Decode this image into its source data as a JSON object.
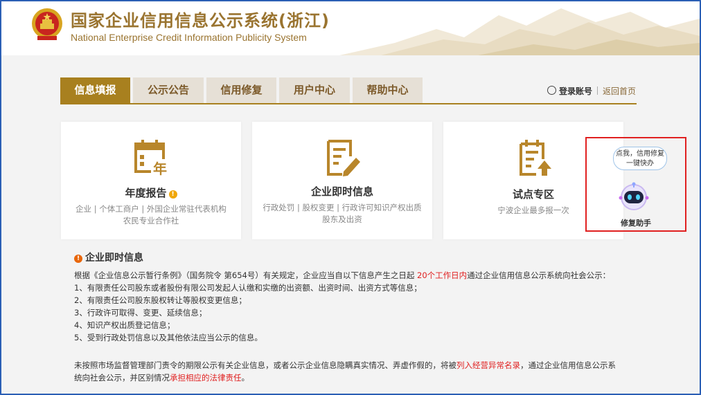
{
  "header": {
    "title": "国家企业信用信息公示系统(浙江)",
    "subtitle": "National Enterprise Credit Information Publicity System"
  },
  "tabs": [
    {
      "label": "信息填报",
      "active": true
    },
    {
      "label": "公示公告",
      "active": false
    },
    {
      "label": "信用修复",
      "active": false
    },
    {
      "label": "用户中心",
      "active": false
    },
    {
      "label": "帮助中心",
      "active": false
    }
  ],
  "account": {
    "login_label": "登录账号",
    "home_label": "返回首页"
  },
  "cards": [
    {
      "title": "年度报告",
      "icon": "annual-report-calendar-icon",
      "badge_icon": "warning-icon",
      "badge_text": "!",
      "desc_line1": "企业 | 个体工商户 | 外国企业常驻代表机构",
      "desc_line2": "农民专业合作社"
    },
    {
      "title": "企业即时信息",
      "icon": "edit-document-icon",
      "desc_line1": "行政处罚 | 股权变更 | 行政许可知识产权出质",
      "desc_line2": "股东及出资"
    },
    {
      "title": "试点专区",
      "icon": "upload-document-icon",
      "desc_line1": "宁波企业最多报一次",
      "desc_line2": ""
    }
  ],
  "assistant": {
    "bubble_line1": "点我，信用修复",
    "bubble_line2": "一键快办",
    "label": "修复助手",
    "icon": "robot-icon"
  },
  "info": {
    "heading_icon_text": "!",
    "heading": "企业即时信息",
    "intro_before": "根据《企业信息公示暂行条例》（国务院令 第654号）有关规定，企业应当自以下信息产生之日起 ",
    "intro_highlight": "20个工作日内",
    "intro_after": "通过企业信用信息公示系统向社会公示：",
    "items": [
      "1、有限责任公司股东或者股份有限公司发起人认缴和实缴的出资额、出资时间、出资方式等信息；",
      "2、有限责任公司股东股权转让等股权变更信息；",
      "3、行政许可取得、变更、延续信息；",
      "4、知识产权出质登记信息；",
      "5、受到行政处罚信息以及其他依法应当公示的信息。"
    ],
    "notice_part1": "未按照市场监督管理部门责令的期限公示有关企业信息，或者公示企业信息隐瞒真实情况、弄虚作假的，将被",
    "notice_red1": "列入经营异常名录",
    "notice_part2": "，通过企业信用信息公示系",
    "notice_part3": "统向社会公示，并区别情况",
    "notice_red2": "承担相应的法律责任",
    "notice_part4": "。"
  },
  "colors": {
    "brand_gold": "#a8801f",
    "highlight_red": "#e02020",
    "frame_blue": "#2b5fb5"
  }
}
